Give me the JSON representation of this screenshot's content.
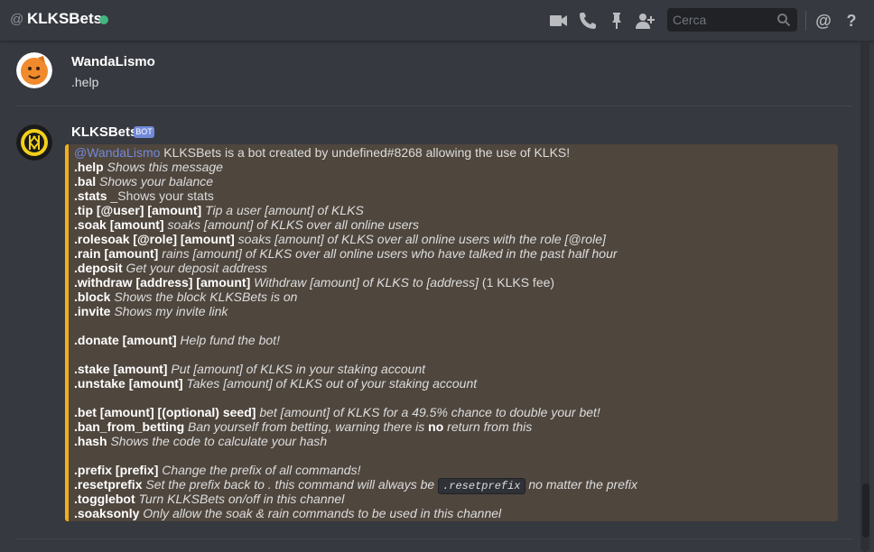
{
  "header": {
    "at_symbol": "@",
    "channel_name": "KLKSBets",
    "search_placeholder": "Cerca",
    "icons": [
      "video-call-icon",
      "voice-call-icon",
      "pin-icon",
      "add-friend-icon",
      "search-icon",
      "mention-icon",
      "help-icon"
    ],
    "status_color": "#43b581"
  },
  "messages": [
    {
      "author": "WandaLismo",
      "text": ".help"
    },
    {
      "author": "KLKSBets",
      "badge": "BOT"
    }
  ],
  "embed": {
    "accent_color": "#f2ae1c",
    "intro": {
      "mention": "@WandaLismo",
      "text": " KLKSBets is a bot created by undefined#8268 allowing the use of KLKS!"
    },
    "lines": [
      {
        "cmd": ".help",
        "desc": " Shows this message"
      },
      {
        "cmd": ".bal",
        "desc": " Shows your balance"
      },
      {
        "cmd": ".stats",
        "desc_plain": " _Shows your stats"
      },
      {
        "cmd": ".tip [@user] [amount]",
        "desc": " Tip a user [amount] of KLKS"
      },
      {
        "cmd": ".soak [amount]",
        "desc": " soaks [amount] of KLKS over all online users"
      },
      {
        "cmd": ".rolesoak [@role] [amount]",
        "desc": " soaks [amount] of KLKS over all online users with the role [@role]"
      },
      {
        "cmd": ".rain [amount]",
        "desc": " rains [amount] of KLKS over all online users who have talked in the past half hour"
      },
      {
        "cmd": ".deposit",
        "desc": " Get your deposit address"
      },
      {
        "cmd": ".withdraw [address] [amount]",
        "desc": " Withdraw [amount] of KLKS to [address]",
        "desc_plain": " (1 KLKS fee)"
      },
      {
        "cmd": ".block",
        "desc": " Shows the block KLKSBets is on"
      },
      {
        "cmd": ".invite",
        "desc": " Shows my invite link"
      },
      {
        "cmd": ".donate [amount]",
        "desc": " Help fund the bot!"
      },
      {
        "cmd": ".stake [amount]",
        "desc": " Put [amount] of KLKS in your staking account"
      },
      {
        "cmd": ".unstake [amount]",
        "desc": " Takes [amount] of KLKS out of your staking account"
      },
      {
        "cmd": ".bet [amount] [(optional) seed]",
        "desc": " bet [amount] of KLKS for a 49.5% chance to double your bet!"
      },
      {
        "cmd": ".ban_from_betting",
        "desc": " Ban yourself from betting, warning there is ",
        "bold_word": "no",
        "desc_tail": " return from this"
      },
      {
        "cmd": ".hash",
        "desc": " Shows the code to calculate your hash"
      },
      {
        "cmd": ".prefix [prefix]",
        "desc": " Change the prefix of all commands!"
      },
      {
        "cmd": ".resetprefix",
        "desc": " Set the prefix back to . this command will always be ",
        "code": ".resetprefix",
        "desc_tail": " no matter the prefix"
      },
      {
        "cmd": ".togglebot",
        "desc": " Turn KLKSBets on/off in this channel"
      },
      {
        "cmd": ".soaksonly",
        "desc": " Only allow the soak & rain commands to be used in this channel"
      }
    ]
  }
}
